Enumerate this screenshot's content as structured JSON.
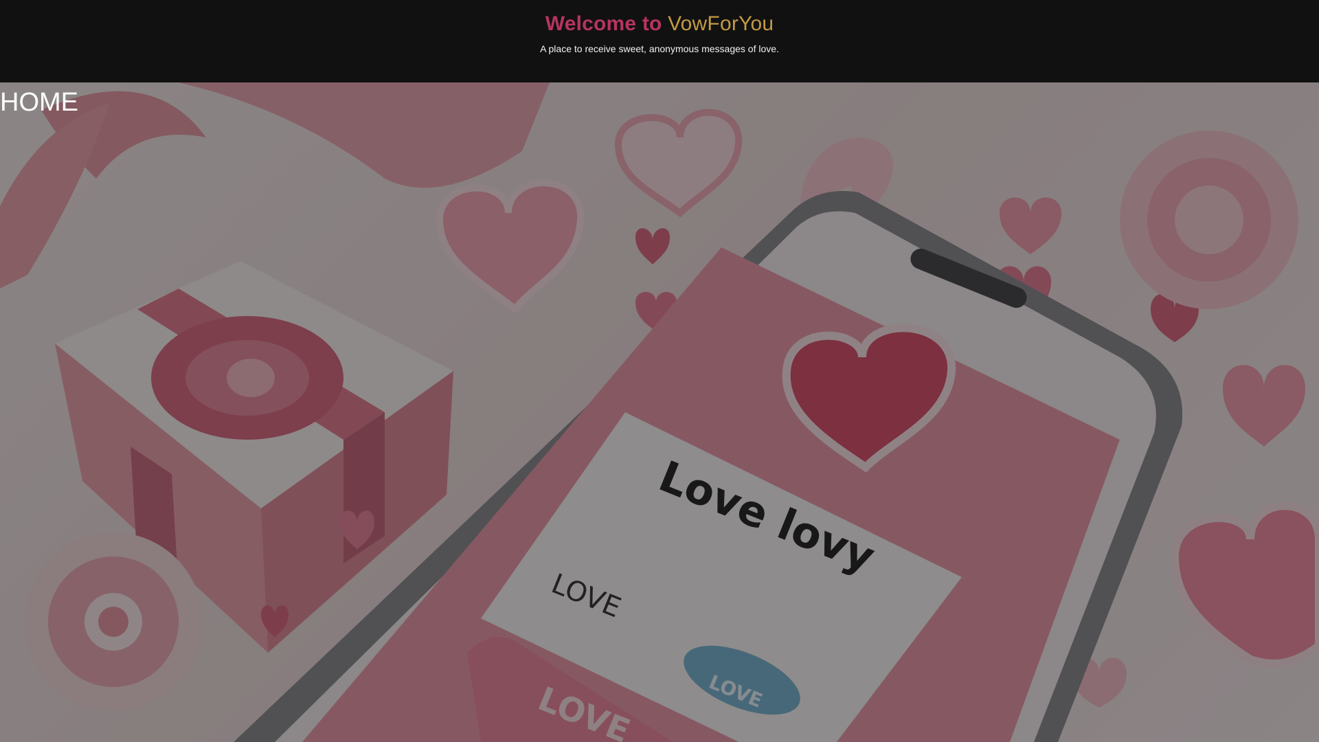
{
  "header": {
    "title_prefix": "Welcome to",
    "title_brand": "VowForYou",
    "subtitle": "A place to receive sweet, anonymous messages of love."
  },
  "hero": {
    "page_label": "HOME",
    "phone_card_title": "Love lovy",
    "phone_card_word": "LOVE",
    "phone_card_button": "LOVE",
    "phone_banner": "LOVE"
  },
  "colors": {
    "title_prefix": "#b5355f",
    "title_brand": "#c49a45",
    "header_bg": "#111111"
  }
}
